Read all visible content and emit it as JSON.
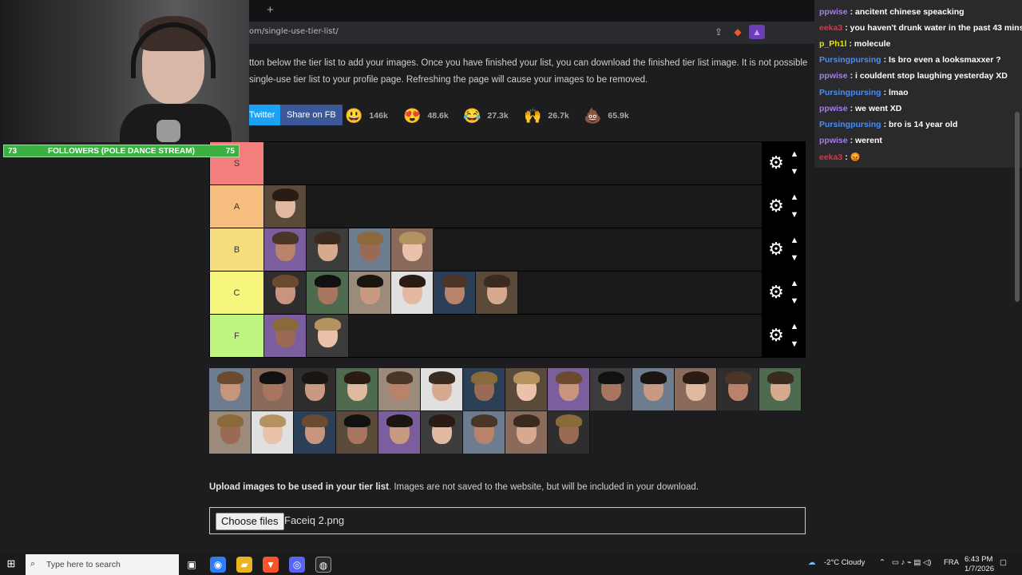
{
  "browser": {
    "new_tab": "+",
    "url": "om/single-use-tier-list/"
  },
  "page": {
    "intro_line1": "tton below the tier list to add your images. Once you have finished your list, you can download the finished tier list image. It is not possible",
    "intro_line2": "single-use tier list to your profile page. Refreshing the page will cause your images to be removed.",
    "share_twitter": "Twitter",
    "share_fb": "Share on FB",
    "reactions": [
      {
        "emoji": "😃",
        "count": "146k"
      },
      {
        "emoji": "😍",
        "count": "48.6k"
      },
      {
        "emoji": "😂",
        "count": "27.3k"
      },
      {
        "emoji": "🙌",
        "count": "26.7k"
      },
      {
        "emoji": "💩",
        "count": "65.9k"
      }
    ],
    "upload_bold": "Upload images to be used in your tier list",
    "upload_rest": ". Images are not saved to the website, but will be included in your download.",
    "choose_files": "Choose files",
    "file_name": "Faceiq 2.png"
  },
  "tiers": [
    {
      "label": "S",
      "color": "#f47f7f",
      "count": 0
    },
    {
      "label": "A",
      "color": "#f6bf7f",
      "count": 1
    },
    {
      "label": "B",
      "color": "#f6de7f",
      "count": 4
    },
    {
      "label": "C",
      "color": "#f6f67f",
      "count": 6
    },
    {
      "label": "F",
      "color": "#bff67f",
      "count": 2
    }
  ],
  "pool_count": 23,
  "stream": {
    "follow_current": "73",
    "follow_label": "FOLLOWERS (POLE DANCE STREAM)",
    "follow_goal": "75"
  },
  "chat": [
    {
      "user": "ppwise",
      "color": "#a87cf0",
      "msg": "ancitent chinese speacking"
    },
    {
      "user": "eeka3",
      "color": "#e0344a",
      "msg": "you haven't drunk water in the past 43 mins"
    },
    {
      "user": "p_Ph1l",
      "color": "#e6e600",
      "msg": "molecule"
    },
    {
      "user": "Pursingpursing",
      "color": "#4c8df6",
      "msg": "Is bro even a looksmaxxer ?"
    },
    {
      "user": "ppwise",
      "color": "#a87cf0",
      "msg": "i couldent stop laughing yesterday XD"
    },
    {
      "user": "Pursingpursing",
      "color": "#4c8df6",
      "msg": "lmao"
    },
    {
      "user": "ppwise",
      "color": "#a87cf0",
      "msg": "we went XD"
    },
    {
      "user": "Pursingpursing",
      "color": "#4c8df6",
      "msg": "bro is 14 year old"
    },
    {
      "user": "ppwise",
      "color": "#a87cf0",
      "msg": "werent"
    },
    {
      "user": "eeka3",
      "color": "#e0344a",
      "msg": "😡"
    }
  ],
  "taskbar": {
    "search_placeholder": "Type here to search",
    "weather": "-2°C  Cloudy",
    "lang": "FRA",
    "time": "6:43 PM",
    "date": "1/7/2026"
  }
}
